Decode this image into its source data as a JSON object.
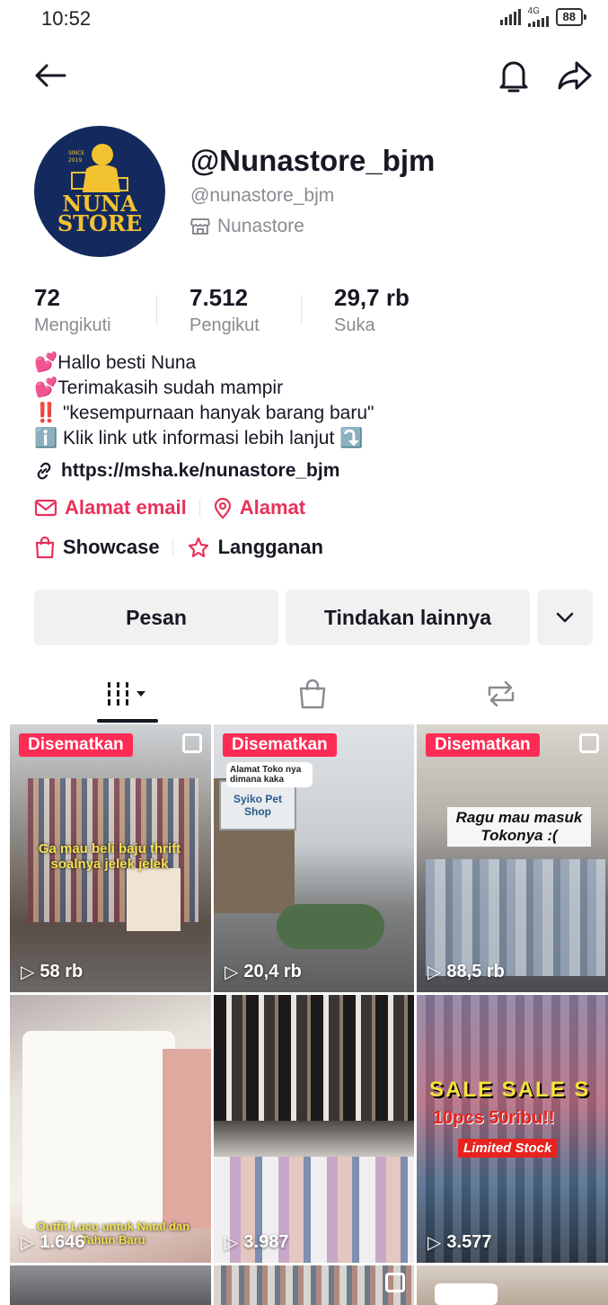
{
  "status_bar": {
    "time": "10:52",
    "network": "4G",
    "battery": "88"
  },
  "profile": {
    "username": "@Nunastore_bjm",
    "handle": "@nunastore_bjm",
    "shop_name": "Nunastore",
    "avatar_text": [
      "NUNA",
      "STORE"
    ],
    "avatar_since": "SINCE 2019"
  },
  "stats": [
    {
      "value": "72",
      "label": "Mengikuti"
    },
    {
      "value": "7.512",
      "label": "Pengikut"
    },
    {
      "value": "29,7 rb",
      "label": "Suka"
    }
  ],
  "bio": [
    "💕Hallo besti Nuna",
    "💕Terimakasih sudah mampir",
    "‼️ \"kesempurnaan hanyak barang baru\"",
    "ℹ️ Klik link utk informasi lebih lanjut ⤵️"
  ],
  "link": "https://msha.ke/nunastore_bjm",
  "contacts": {
    "email_label": "Alamat email",
    "address_label": "Alamat"
  },
  "shop_links": {
    "showcase": "Showcase",
    "subscription": "Langganan"
  },
  "actions": {
    "message": "Pesan",
    "more": "Tindakan lainnya"
  },
  "videos": [
    {
      "pinned_label": "Disematkan",
      "views": "58 rb",
      "overlay": "Ga mau beli baju thrift soalnya jelek jelek"
    },
    {
      "pinned_label": "Disematkan",
      "views": "20,4 rb",
      "overlay": "Alamat Toko nya dimana kaka",
      "sign": "Syiko Pet Shop"
    },
    {
      "pinned_label": "Disematkan",
      "views": "88,5 rb",
      "overlay": "Ragu mau masuk Tokonya :("
    },
    {
      "views": "1.646",
      "overlay": "Outfit Lucu untuk Natal dan Tahun Baru"
    },
    {
      "views": "3.987"
    },
    {
      "views": "3.577",
      "overlay": "SALE SALE S",
      "overlay2": "10pcs 50ribu!!",
      "overlay3": "Limited Stock"
    }
  ],
  "colors": {
    "accent": "#fe2c55",
    "link_red": "#e8325a",
    "button_bg": "#f1f1f2"
  }
}
